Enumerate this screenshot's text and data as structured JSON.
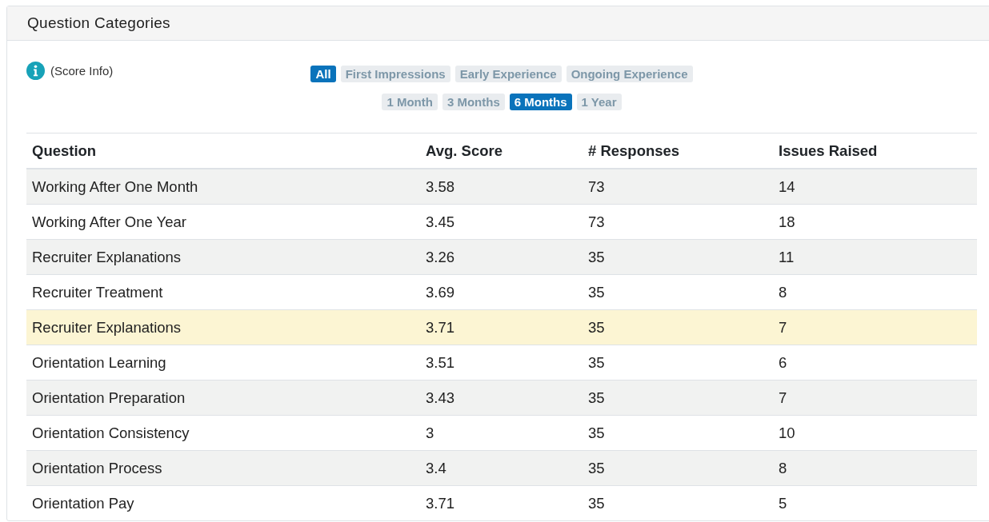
{
  "panel": {
    "title": "Question Categories"
  },
  "score_info": {
    "label": "(Score Info)"
  },
  "category_filters": [
    {
      "label": "All",
      "selected": true
    },
    {
      "label": "First Impressions",
      "selected": false
    },
    {
      "label": "Early Experience",
      "selected": false
    },
    {
      "label": "Ongoing Experience",
      "selected": false
    }
  ],
  "period_filters": [
    {
      "label": "1 Month",
      "selected": false
    },
    {
      "label": "3 Months",
      "selected": false
    },
    {
      "label": "6 Months",
      "selected": true
    },
    {
      "label": "1 Year",
      "selected": false
    }
  ],
  "table": {
    "columns": [
      "Question",
      "Avg. Score",
      "# Responses",
      "Issues Raised"
    ],
    "rows": [
      {
        "cells": [
          "Working After One Month",
          "3.58",
          "73",
          "14"
        ],
        "highlighted": false
      },
      {
        "cells": [
          "Working After One Year",
          "3.45",
          "73",
          "18"
        ],
        "highlighted": false
      },
      {
        "cells": [
          "Recruiter Explanations",
          "3.26",
          "35",
          "11"
        ],
        "highlighted": false
      },
      {
        "cells": [
          "Recruiter Treatment",
          "3.69",
          "35",
          "8"
        ],
        "highlighted": false
      },
      {
        "cells": [
          "Recruiter Explanations",
          "3.71",
          "35",
          "7"
        ],
        "highlighted": true
      },
      {
        "cells": [
          "Orientation Learning",
          "3.51",
          "35",
          "6"
        ],
        "highlighted": false
      },
      {
        "cells": [
          "Orientation Preparation",
          "3.43",
          "35",
          "7"
        ],
        "highlighted": false
      },
      {
        "cells": [
          "Orientation Consistency",
          "3",
          "35",
          "10"
        ],
        "highlighted": false
      },
      {
        "cells": [
          "Orientation Process",
          "3.4",
          "35",
          "8"
        ],
        "highlighted": false
      },
      {
        "cells": [
          "Orientation Pay",
          "3.71",
          "35",
          "5"
        ],
        "highlighted": false
      }
    ]
  }
}
